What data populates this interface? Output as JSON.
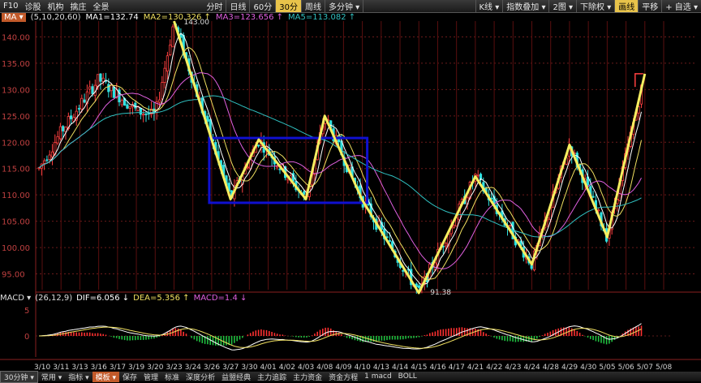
{
  "toolbar": {
    "f10": "F10",
    "diagnose": "诊股",
    "institution": "机构",
    "pick": "擒庄",
    "panorama": "全景",
    "periods": [
      "分时",
      "日线",
      "60分",
      "30分",
      "周线",
      "多分钟 ▾"
    ],
    "active_period": "30分",
    "right_items": [
      "K线 ▾",
      "指数叠加 ▾",
      "2图 ▾",
      "下除权 ▾",
      "画线",
      "平移",
      "+ 自选 ▾"
    ],
    "highlight_item": "画线"
  },
  "ma_legend": {
    "button": "MA ▾",
    "params": "(5,10,20,60)",
    "ma1": "MA1=132.74",
    "ma2": "MA2=130.326 ↑",
    "ma3": "MA3=123.656 ↑",
    "ma5": "MA5=113.082 ↑",
    "colors": {
      "ma1": "#ffffff",
      "ma2": "#f0e060",
      "ma3": "#e060e0",
      "ma5": "#30c0c0"
    }
  },
  "macd_legend": {
    "name": "MACD ▾",
    "params": "(26,12,9)",
    "dif": "DIF=6.056 ↓",
    "dea": "DEA=5.356 ↑",
    "macd": "MACD=1.4 ↓"
  },
  "bottom_tabs": {
    "tag": "30分钟 ▾",
    "items": [
      "常用 ▾",
      "指标 ▾",
      "模板 ▾",
      "保存",
      "管理",
      "标准",
      "深度分析",
      "益盟经典",
      "主力追踪",
      "主力资金",
      "资金方程",
      "1 macd",
      "BOLL"
    ],
    "active": "模板 ▾"
  },
  "chart_data": [
    {
      "type": "candlestick",
      "y_ticks": [
        "140.00",
        "135.00",
        "130.00",
        "125.00",
        "120.00",
        "115.00",
        "110.00",
        "105.00",
        "100.00",
        "95.00"
      ],
      "x_labels": [
        "3/10",
        "3/11",
        "3/13",
        "3/16",
        "3/17",
        "3/19",
        "3/20",
        "3/23",
        "3/24",
        "3/26",
        "3/27",
        "3/30",
        "4/01",
        "4/02",
        "4/03",
        "4/08",
        "4/09",
        "4/10",
        "4/13",
        "4/14",
        "4/15",
        "4/16",
        "4/17",
        "4/21",
        "4/22",
        "4/23",
        "4/24",
        "4/28",
        "4/29",
        "4/30",
        "5/05",
        "5/06",
        "5/07",
        "5/08"
      ],
      "annotations": [
        "143.00",
        "91.38"
      ],
      "ylim": [
        92,
        143
      ],
      "zigzag": [
        {
          "x": "3/23",
          "y": 143.0
        },
        {
          "x": "3/27",
          "y": 109.2
        },
        {
          "x": "3/31",
          "y": 120.5
        },
        {
          "x": "4/03",
          "y": 109.2
        },
        {
          "x": "4/08",
          "y": 125.0
        },
        {
          "x": "4/10",
          "y": 109.0
        },
        {
          "x": "4/15",
          "y": 91.38
        },
        {
          "x": "4/21",
          "y": 113.5
        },
        {
          "x": "4/24",
          "y": 96.8
        },
        {
          "x": "4/29",
          "y": 119.5
        },
        {
          "x": "5/05",
          "y": 102.0
        },
        {
          "x": "5/07",
          "y": 133.0
        }
      ],
      "consolidation_box": {
        "from": "3/26",
        "to": "4/10",
        "low": 108.5,
        "high": 120.8
      }
    },
    {
      "type": "macd",
      "y_ticks": [
        "5",
        "0"
      ]
    }
  ]
}
